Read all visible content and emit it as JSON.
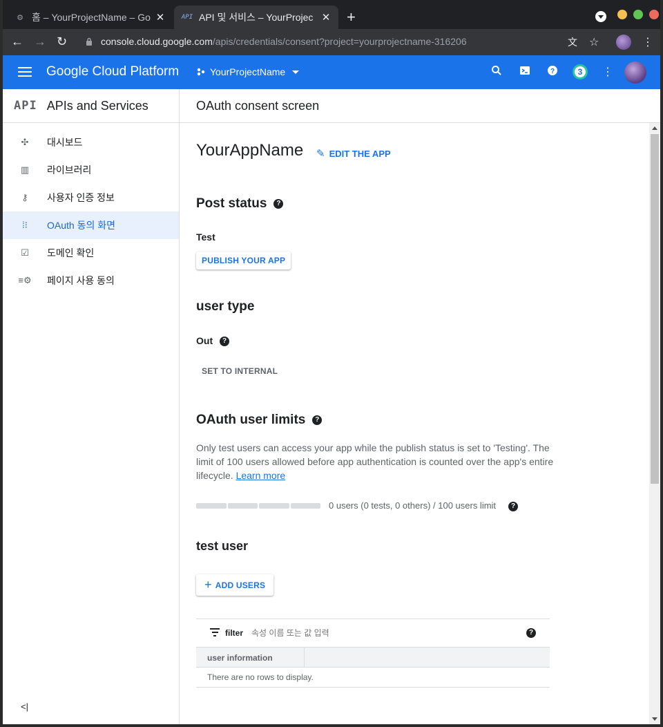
{
  "browser": {
    "tabs": [
      {
        "title": "홈 – YourProjectName – Go",
        "favicon": "gear-icon"
      },
      {
        "title": "API 및 서비스 – YourProjec",
        "favicon": "API"
      }
    ],
    "url_host": "console.cloud.google.com",
    "url_path": "/apis/credentials/consent?project=yourprojectname-316206",
    "window_colors": [
      "#f5bf4f",
      "#61c554",
      "#ed6a5e"
    ]
  },
  "header": {
    "product": "Google Cloud Platform",
    "project": "YourProjectName",
    "notifications": "3",
    "accent": "#1a73e8"
  },
  "sidebar": {
    "logo": "API",
    "title": "APIs and Services",
    "items": [
      {
        "label": "대시보드",
        "icon": "dashboard-icon"
      },
      {
        "label": "라이브러리",
        "icon": "library-icon"
      },
      {
        "label": "사용자 인증 정보",
        "icon": "key-icon"
      },
      {
        "label": "OAuth 동의 화면",
        "icon": "consent-icon"
      },
      {
        "label": "도메인 확인",
        "icon": "checkbox-icon"
      },
      {
        "label": "페이지 사용 동의",
        "icon": "settings-list-icon"
      }
    ],
    "active_index": 3,
    "collapse": "<|"
  },
  "main": {
    "page_title": "OAuth consent screen",
    "app_name": "YourAppName",
    "edit_app": "EDIT THE APP",
    "post_status": {
      "heading": "Post status",
      "value": "Test",
      "button": "PUBLISH YOUR APP"
    },
    "user_type": {
      "heading": "user type",
      "value": "Out",
      "button": "SET TO INTERNAL"
    },
    "limits": {
      "heading": "OAuth user limits",
      "text": "Only test users can access your app while the publish status is set to 'Testing'. The limit of 100 users allowed before app authentication is counted over the app's entire lifecycle.",
      "link": "Learn more",
      "usage": "0 users (0 tests, 0 others) / 100 users limit",
      "progress_fraction": 0
    },
    "test_user": {
      "heading": "test user",
      "button": "ADD USERS",
      "filter_label": "filter",
      "filter_placeholder": "속성 이름 또는 값 입력",
      "column": "user information",
      "empty": "There are no rows to display."
    }
  }
}
